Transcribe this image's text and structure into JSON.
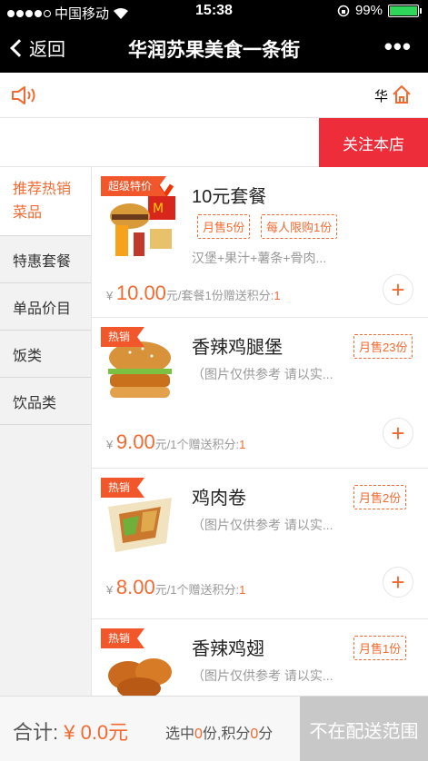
{
  "status": {
    "carrier": "中国移动",
    "time": "15:38",
    "battery": "99%",
    "battery_level": 0.99
  },
  "nav": {
    "back_label": "返回",
    "title": "华润苏果美食一条街",
    "more": "•••"
  },
  "notice": {
    "text": "华"
  },
  "follow": {
    "label": "关注本店"
  },
  "categories": [
    {
      "label_line1": "推荐热销",
      "label_line2": "菜品"
    },
    {
      "label": "特惠套餐"
    },
    {
      "label": "单品价目"
    },
    {
      "label": "饭类"
    },
    {
      "label": "饮品类"
    }
  ],
  "items": [
    {
      "ribbon": "超级特价",
      "name": "10元套餐",
      "tags": [
        "月售5份",
        "每人限购1份"
      ],
      "desc": "汉堡+果汁+薯条+骨肉...",
      "currency": "¥",
      "price": "10.00",
      "unit": "元/套餐1份赠送积分:",
      "points": "1",
      "add": "+"
    },
    {
      "ribbon": "热销",
      "name": "香辣鸡腿堡",
      "tags": [
        "月售23份"
      ],
      "desc": "（图片仅供参考 请以实...",
      "currency": "¥",
      "price": "9.00",
      "unit": "元/1个赠送积分:",
      "points": "1",
      "add": "+"
    },
    {
      "ribbon": "热销",
      "name": "鸡肉卷",
      "tags": [
        "月售2份"
      ],
      "desc": "（图片仅供参考 请以实...",
      "currency": "¥",
      "price": "8.00",
      "unit": "元/1个赠送积分:",
      "points": "1",
      "add": "+"
    },
    {
      "ribbon": "热销",
      "name": "香辣鸡翅",
      "tags": [
        "月售1份"
      ],
      "desc": "（图片仅供参考 请以实...",
      "currency": "¥",
      "price": "",
      "unit": "",
      "points": "",
      "add": "+"
    }
  ],
  "footer": {
    "total_label": "合计: ",
    "total_amount": "¥ 0.0元",
    "sel_prefix": "选中",
    "sel_count": "0",
    "sel_mid": "份,积分",
    "sel_points": "0",
    "sel_suffix": "分",
    "status_button": "不在配送范围"
  },
  "colors": {
    "accent": "#f36a30",
    "follow_red": "#ee2d3a",
    "disabled_gray": "#c8c8c8"
  }
}
